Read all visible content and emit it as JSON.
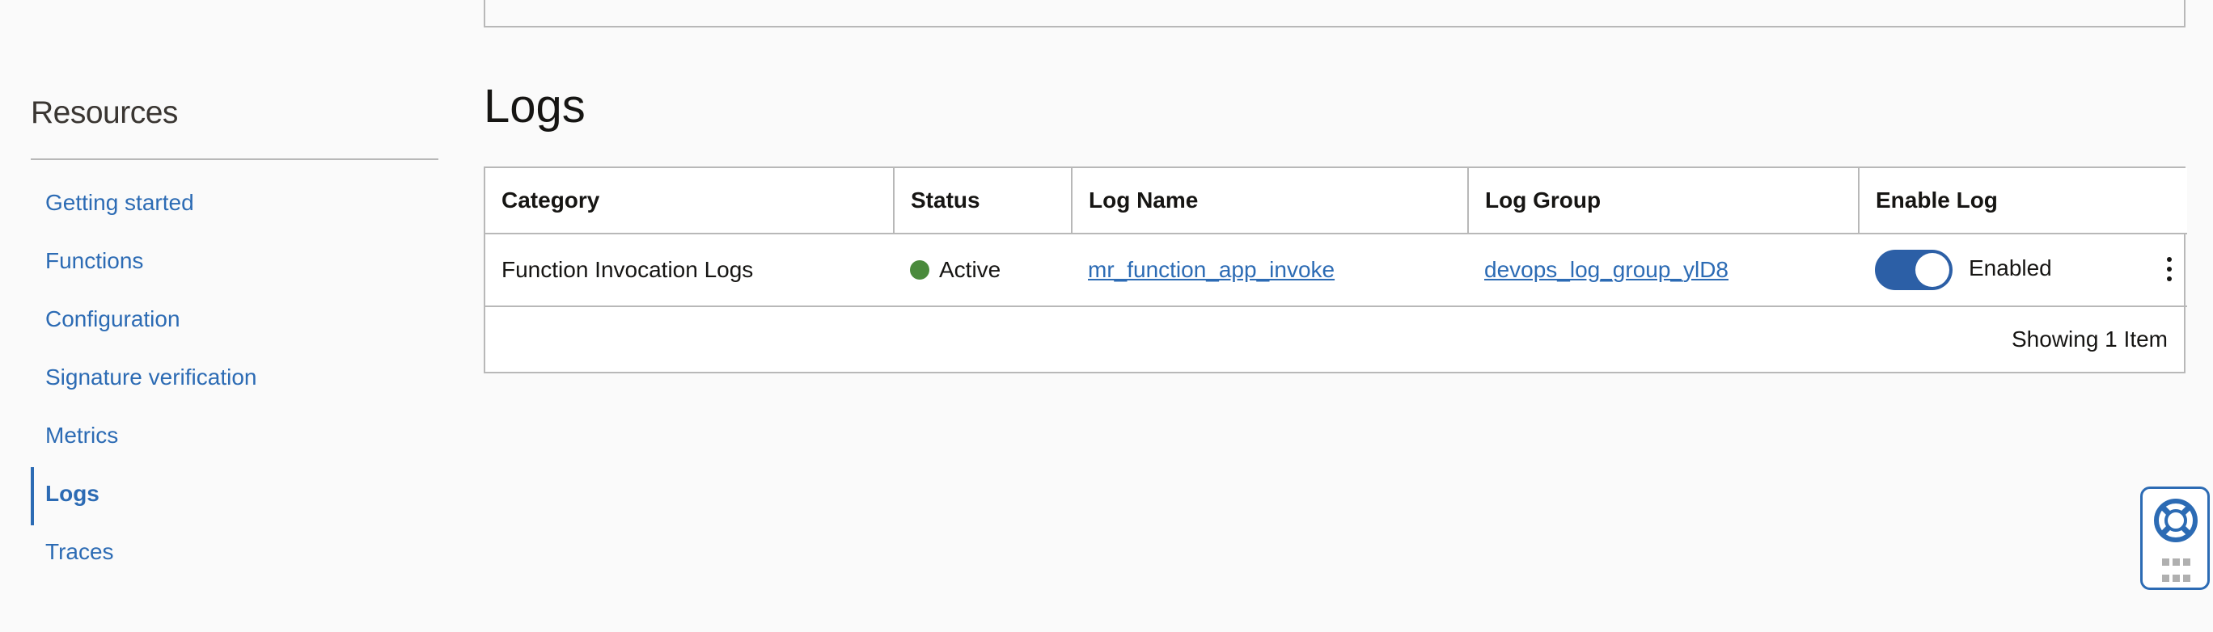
{
  "sidebar": {
    "title": "Resources",
    "items": [
      {
        "label": "Getting started",
        "active": false
      },
      {
        "label": "Functions",
        "active": false
      },
      {
        "label": "Configuration",
        "active": false
      },
      {
        "label": "Signature verification",
        "active": false
      },
      {
        "label": "Metrics",
        "active": false
      },
      {
        "label": "Logs",
        "active": true
      },
      {
        "label": "Traces",
        "active": false
      }
    ]
  },
  "main": {
    "title": "Logs",
    "table": {
      "columns": [
        "Category",
        "Status",
        "Log Name",
        "Log Group",
        "Enable Log"
      ],
      "rows": [
        {
          "category": "Function Invocation Logs",
          "status": "Active",
          "log_name": "mr_function_app_invoke",
          "log_group": "devops_log_group_ylD8",
          "enable_label": "Enabled",
          "enabled": true
        }
      ],
      "footer": "Showing 1 Item"
    }
  },
  "colors": {
    "link": "#2c6bb4",
    "toggle_on": "#2c5fa6",
    "status_active": "#4a8a3c",
    "border": "#b8b8b8"
  },
  "icons": {
    "help": "lifebuoy-icon",
    "grip": "drag-handle-icon",
    "row_actions": "kebab-menu-icon"
  }
}
